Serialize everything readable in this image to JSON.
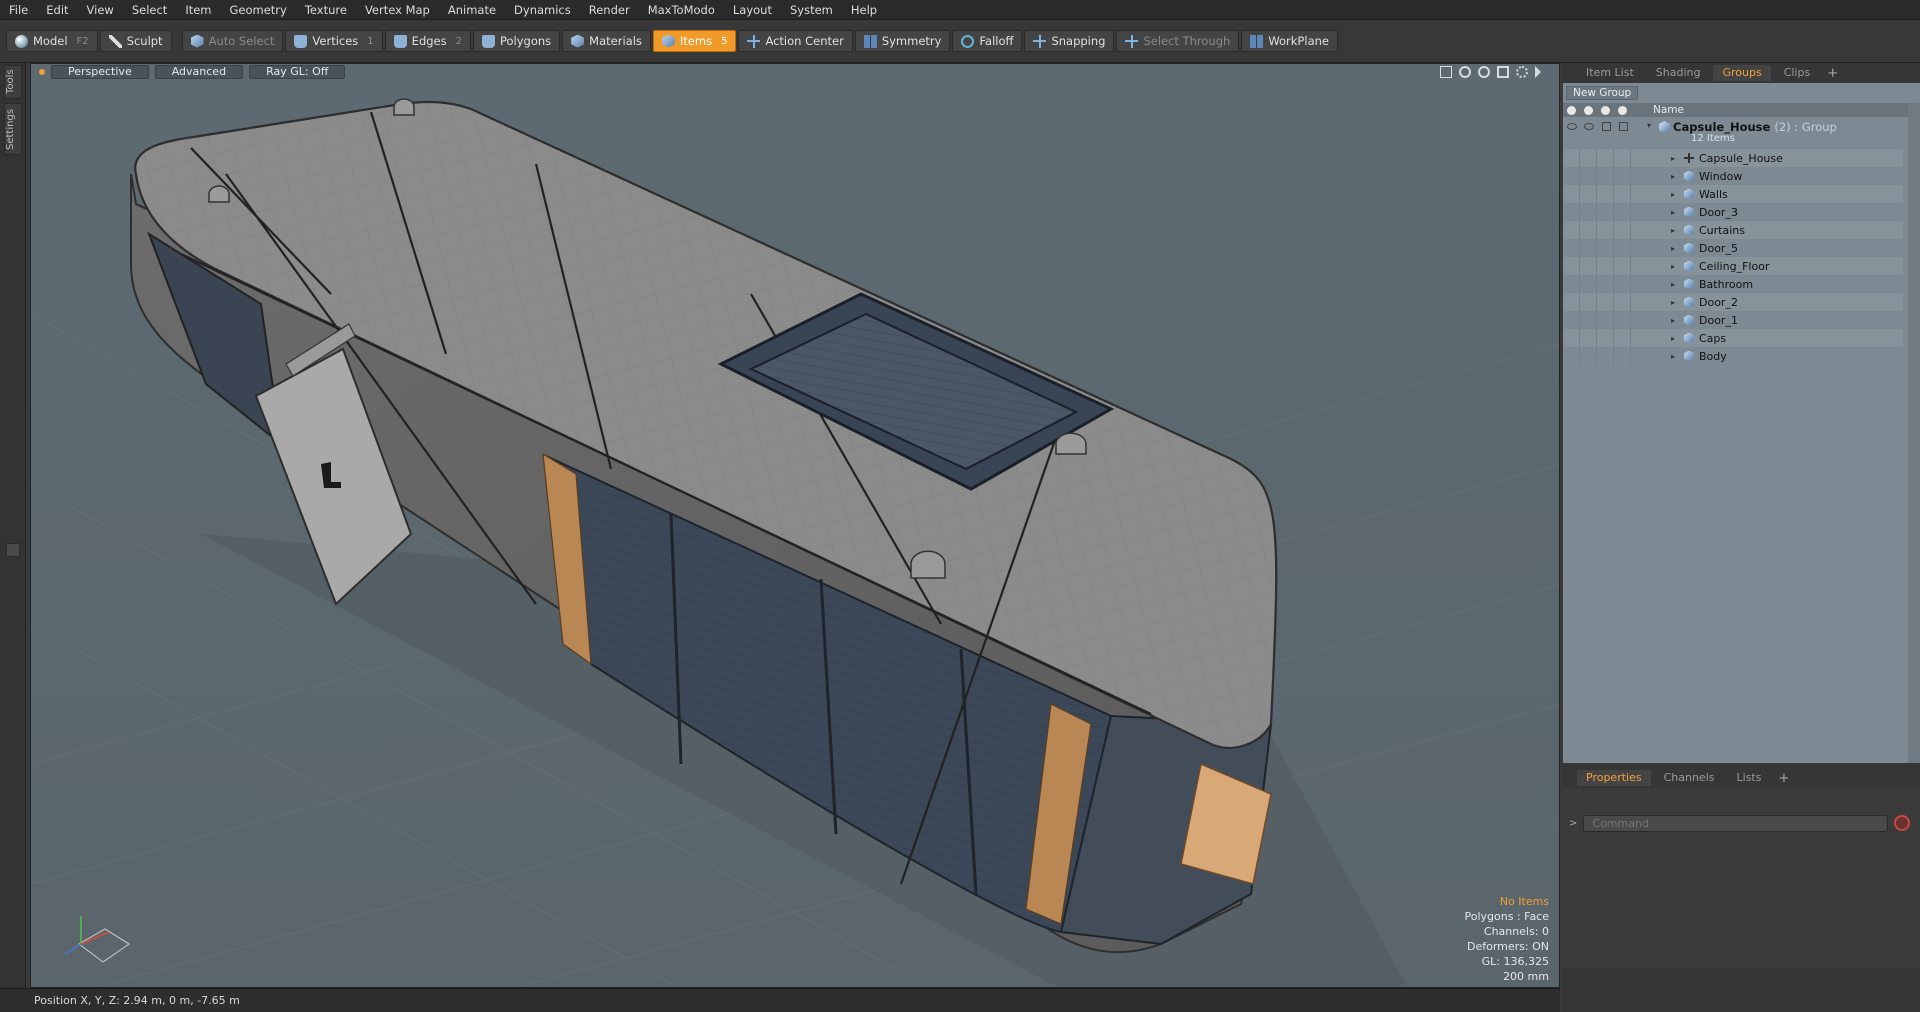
{
  "menu": [
    "File",
    "Edit",
    "View",
    "Select",
    "Item",
    "Geometry",
    "Texture",
    "Vertex Map",
    "Animate",
    "Dynamics",
    "Render",
    "MaxToModo",
    "Layout",
    "System",
    "Help"
  ],
  "toolbar": {
    "model": "Model",
    "model_key": "F2",
    "sculpt": "Sculpt",
    "auto_select": "Auto Select",
    "vertices": "Vertices",
    "vertices_key": "1",
    "edges": "Edges",
    "edges_key": "2",
    "polygons": "Polygons",
    "materials": "Materials",
    "items": "Items",
    "items_key": "5",
    "action_center": "Action Center",
    "symmetry": "Symmetry",
    "falloff": "Falloff",
    "snapping": "Snapping",
    "select_through": "Select Through",
    "workplane": "WorkPlane"
  },
  "left_strip": {
    "tools": "Tools",
    "settings": "Settings"
  },
  "viewport": {
    "view_mode": "Perspective",
    "shading": "Advanced",
    "ray_gl": "Ray GL: Off",
    "hud": {
      "selection": "No Items",
      "polygons": "Polygons : Face",
      "channels": "Channels: 0",
      "deformers": "Deformers: ON",
      "gl": "GL: 136,325",
      "grid": "200 mm"
    }
  },
  "status": {
    "position": "Position X, Y, Z:   2.94 m, 0 m, -7.65 m"
  },
  "right_panel": {
    "tabs": [
      "Item List",
      "Shading",
      "Groups",
      "Clips"
    ],
    "active_tab": "Groups",
    "new_group": "New Group",
    "column_name": "Name",
    "group": {
      "name": "Capsule_House",
      "count": "(2) : Group",
      "subtitle": "12 Items"
    },
    "items": [
      "Capsule_House",
      "Window",
      "Walls",
      "Door_3",
      "Curtains",
      "Door_5",
      "Ceiling_Floor",
      "Bathroom",
      "Door_2",
      "Door_1",
      "Caps",
      "Body"
    ],
    "bottom_tabs": [
      "Properties",
      "Channels",
      "Lists"
    ],
    "bottom_active": "Properties",
    "command_placeholder": "Command"
  },
  "colors": {
    "accent": "#f09a2a",
    "viewport_bg": "#5e6a71",
    "tree_bg": "#7e8a93"
  }
}
